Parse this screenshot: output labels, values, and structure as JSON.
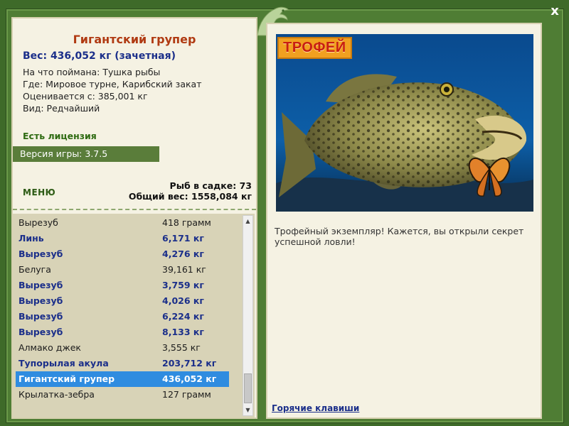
{
  "window": {
    "close_label": "x"
  },
  "fish": {
    "title": "Гигантский групер",
    "weight_line": "Вес: 436,052 кг (зачетная)",
    "caught_with": "На что поймана: Тушка рыбы",
    "location": "Где: Мировое турне, Карибский закат",
    "valued_from": "Оценивается с: 385,001 кг",
    "kind": "Вид: Редчайший"
  },
  "license": "Есть лицензия",
  "version": "Версия игры: 3.7.5",
  "menu_label": "МЕНЮ",
  "stats": {
    "fish_count": "Рыб в садке: 73",
    "total_weight": "Общий вес: 1558,084 кг"
  },
  "catch_list": [
    {
      "name": "Вырезуб",
      "weight": "418 грамм",
      "style": "normal"
    },
    {
      "name": "Линь",
      "weight": "6,171 кг",
      "style": "bold"
    },
    {
      "name": "Вырезуб",
      "weight": "4,276 кг",
      "style": "bold"
    },
    {
      "name": "Белуга",
      "weight": "39,161 кг",
      "style": "normal"
    },
    {
      "name": "Вырезуб",
      "weight": "3,759 кг",
      "style": "bold"
    },
    {
      "name": "Вырезуб",
      "weight": "4,026 кг",
      "style": "bold"
    },
    {
      "name": "Вырезуб",
      "weight": "6,224 кг",
      "style": "bold"
    },
    {
      "name": "Вырезуб",
      "weight": "8,133 кг",
      "style": "bold"
    },
    {
      "name": "Алмако джек",
      "weight": "3,555 кг",
      "style": "normal"
    },
    {
      "name": "Тупорылая акула",
      "weight": "203,712 кг",
      "style": "bold"
    },
    {
      "name": "Гигантский групер",
      "weight": "436,052 кг",
      "style": "selected"
    },
    {
      "name": "Крылатка-зебра",
      "weight": "127 грамм",
      "style": "normal"
    }
  ],
  "trophy_badge": "ТРОФЕЙ",
  "description": "Трофейный экземпляр! Кажется, вы открыли секрет успешной ловли!",
  "hotkeys_label": "Горячие клавиши",
  "icons": {
    "close": "close-icon",
    "emblem": "leaping-fish-emblem-icon",
    "scroll_up": "scroll-up-icon",
    "scroll_down": "scroll-down-icon"
  },
  "colors": {
    "frame_green": "#4f7d34",
    "panel_bg": "#f5f2e3",
    "title_red": "#b03a12",
    "accent_blue": "#1b2f8a",
    "selection_blue": "#2f8ce0",
    "license_green": "#2e6b12"
  }
}
